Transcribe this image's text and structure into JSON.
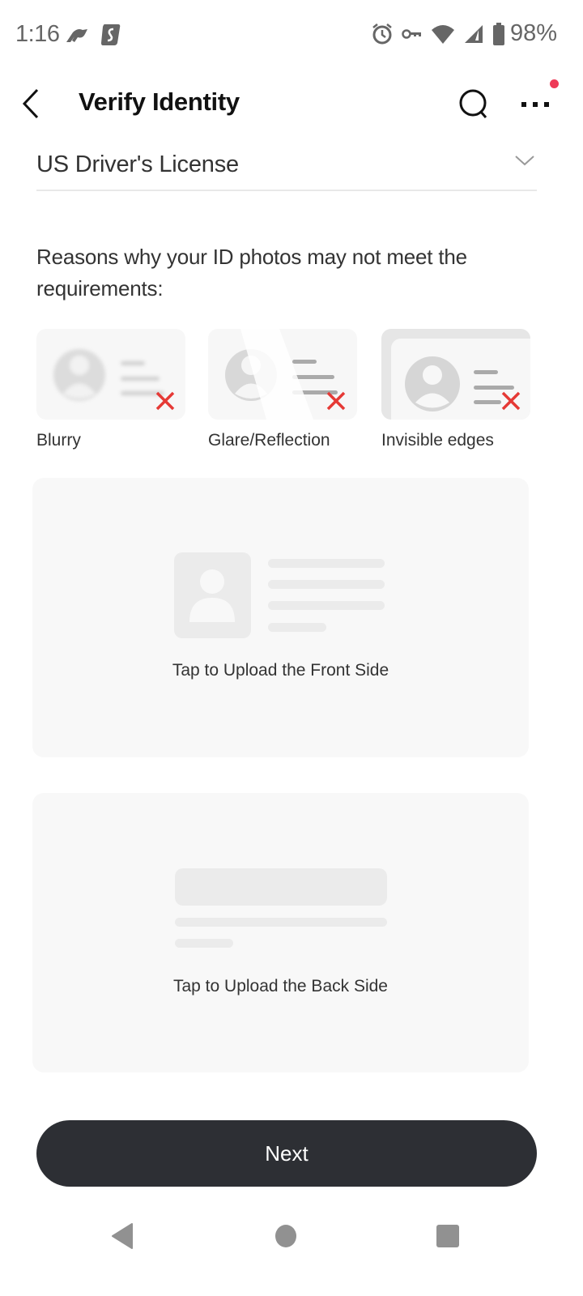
{
  "status_bar": {
    "time": "1:16",
    "left_icons": [
      "vpn-app-icon",
      "surfshark-icon"
    ],
    "right_icons": [
      "alarm-icon",
      "vpn-key-icon",
      "wifi-icon",
      "signal-icon",
      "battery-icon"
    ],
    "battery": "98%"
  },
  "app_bar": {
    "title": "Verify Identity",
    "has_notification_dot": true
  },
  "document_type": {
    "selected": "US Driver's License"
  },
  "reasons": {
    "heading": "Reasons why your ID photos may not meet the requirements:",
    "items": [
      {
        "label": "Blurry",
        "icon": "blurry-id-icon"
      },
      {
        "label": "Glare/Reflection",
        "icon": "glare-id-icon"
      },
      {
        "label": "Invisible edges",
        "icon": "edges-id-icon"
      }
    ]
  },
  "uploads": {
    "front": {
      "label": "Tap to Upload the Front Side"
    },
    "back": {
      "label": "Tap to Upload the Back Side"
    }
  },
  "actions": {
    "next_label": "Next"
  },
  "colors": {
    "primary_button": "#2d2f34",
    "error_x": "#e53935",
    "notification_dot": "#ee3a57",
    "placeholder_bg": "#f8f8f8"
  }
}
